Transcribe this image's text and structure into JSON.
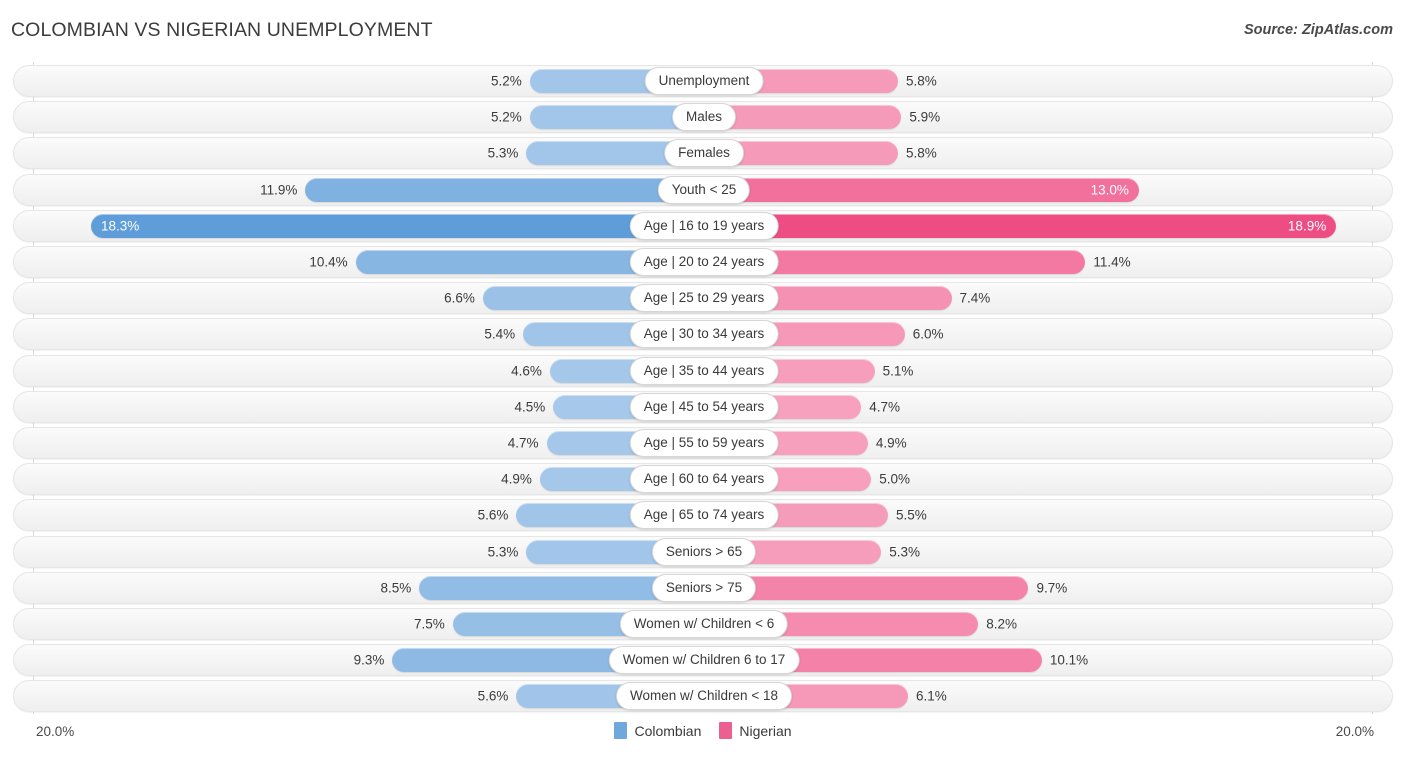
{
  "header": {
    "title": "COLOMBIAN VS NIGERIAN UNEMPLOYMENT",
    "source": "Source: ZipAtlas.com"
  },
  "axis": {
    "left_label": "20.0%",
    "right_label": "20.0%",
    "max": 20.0
  },
  "legend": {
    "items": [
      {
        "label": "Colombian",
        "color": "#6fa8dc"
      },
      {
        "label": "Nigerian",
        "color": "#ec5f91"
      }
    ]
  },
  "colors": {
    "colombian_light": "#a6c8ea",
    "colombian_dark": "#5b9bd8",
    "nigerian_light": "#f7a2bf",
    "nigerian_dark": "#ee4d84",
    "track": "#f4f4f4",
    "gridline": "#dcdcdc"
  },
  "chart_data": {
    "type": "bar",
    "orientation": "horizontal-diverging",
    "title": "COLOMBIAN VS NIGERIAN UNEMPLOYMENT",
    "xlabel": "",
    "ylabel": "",
    "xlim": [
      20.0,
      20.0
    ],
    "grid": true,
    "legend_position": "bottom-center",
    "unit": "%",
    "categories": [
      "Unemployment",
      "Males",
      "Females",
      "Youth < 25",
      "Age | 16 to 19 years",
      "Age | 20 to 24 years",
      "Age | 25 to 29 years",
      "Age | 30 to 34 years",
      "Age | 35 to 44 years",
      "Age | 45 to 54 years",
      "Age | 55 to 59 years",
      "Age | 60 to 64 years",
      "Age | 65 to 74 years",
      "Seniors > 65",
      "Seniors > 75",
      "Women w/ Children < 6",
      "Women w/ Children 6 to 17",
      "Women w/ Children < 18"
    ],
    "series": [
      {
        "name": "Colombian",
        "values": [
          5.2,
          5.2,
          5.3,
          11.9,
          18.3,
          10.4,
          6.6,
          5.4,
          4.6,
          4.5,
          4.7,
          4.9,
          5.6,
          5.3,
          8.5,
          7.5,
          9.3,
          5.6
        ],
        "labels": [
          "5.2%",
          "5.2%",
          "5.3%",
          "11.9%",
          "18.3%",
          "10.4%",
          "6.6%",
          "5.4%",
          "4.6%",
          "4.5%",
          "4.7%",
          "4.9%",
          "5.6%",
          "5.3%",
          "8.5%",
          "7.5%",
          "9.3%",
          "5.6%"
        ]
      },
      {
        "name": "Nigerian",
        "values": [
          5.8,
          5.9,
          5.8,
          13.0,
          18.9,
          11.4,
          7.4,
          6.0,
          5.1,
          4.7,
          4.9,
          5.0,
          5.5,
          5.3,
          9.7,
          8.2,
          10.1,
          6.1
        ],
        "labels": [
          "5.8%",
          "5.9%",
          "5.8%",
          "13.0%",
          "18.9%",
          "11.4%",
          "7.4%",
          "6.0%",
          "5.1%",
          "4.7%",
          "4.9%",
          "5.0%",
          "5.5%",
          "5.3%",
          "9.7%",
          "8.2%",
          "10.1%",
          "6.1%"
        ]
      }
    ]
  }
}
